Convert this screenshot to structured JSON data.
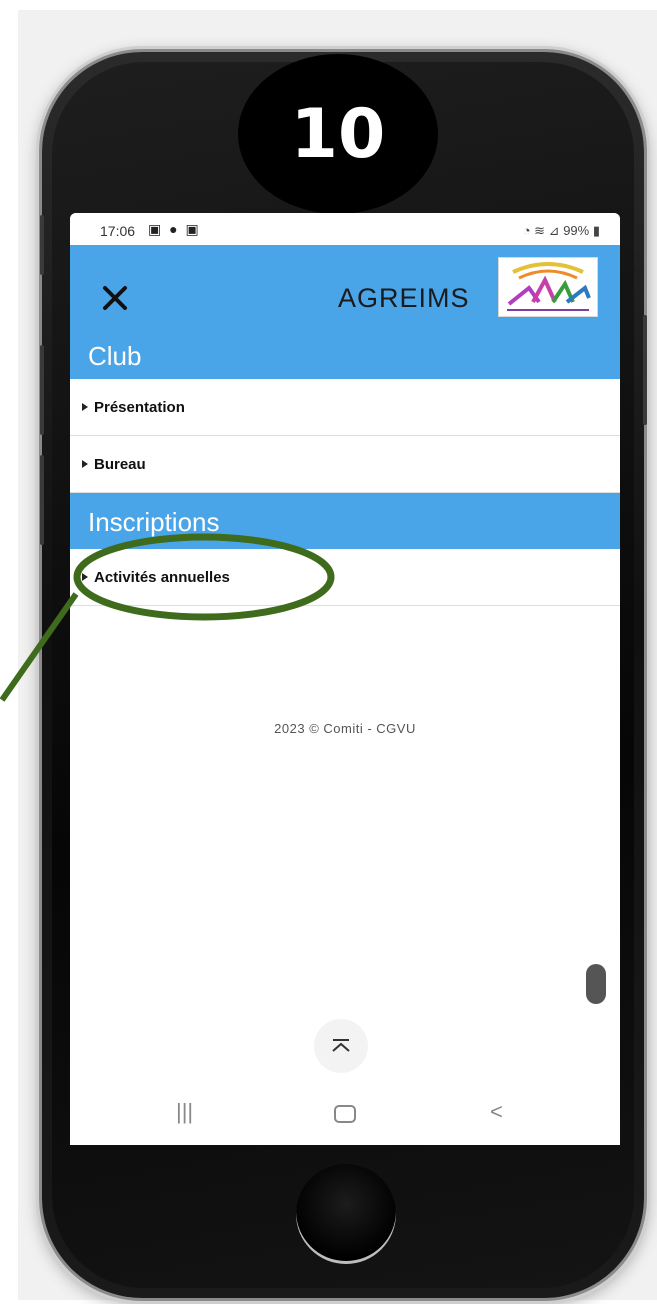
{
  "step_badge": {
    "number": "10"
  },
  "status_bar": {
    "time": "17:06",
    "battery": "99%"
  },
  "app_bar": {
    "title": "AGREIMS",
    "close_icon": "close-icon",
    "logo": "club-logo"
  },
  "sections": [
    {
      "title": "Club",
      "items": [
        "Présentation",
        "Bureau"
      ]
    },
    {
      "title": "Inscriptions",
      "items": [
        "Activités annuelles"
      ]
    }
  ],
  "footer": {
    "text": "2023 © Comiti - CGVU"
  },
  "nav_bar": {
    "recent_icon": "recent-apps-icon",
    "home_icon": "home-icon",
    "back_icon": "back-icon"
  },
  "colors": {
    "accent": "#4aa4e8",
    "highlight": "#3f6b1c",
    "phone_body": "#111111"
  }
}
